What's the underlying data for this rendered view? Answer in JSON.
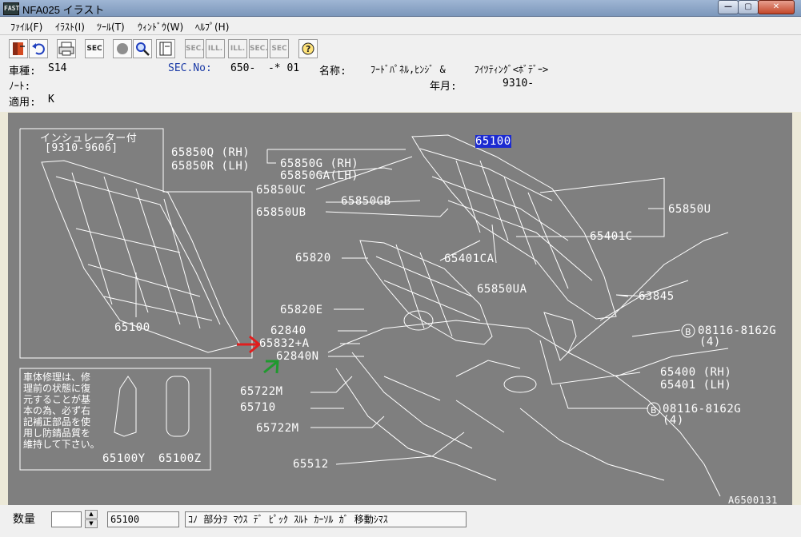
{
  "window": {
    "title": "NFA025 イラスト",
    "app_icon_text": "FAST"
  },
  "menu": [
    "ﾌｧｲﾙ(F)",
    "ｲﾗｽﾄ(I)",
    "ﾂｰﾙ(T)",
    "ｳｨﾝﾄﾞｳ(W)",
    "ﾍﾙﾌﾟ(H)"
  ],
  "toolbar": {
    "sec": "SEC",
    "sec_prev": "SEC.",
    "ill_prev": "ILL.",
    "ill_next": "ILL.",
    "sec_next": "SEC.",
    "sec_q": "SEC"
  },
  "info": {
    "vehicle_label": "車種:",
    "vehicle_value": "S14",
    "sec_label": "SEC.No:",
    "sec_value": "650-  -* 01",
    "name_label": "名称:",
    "name_value": "ﾌｰﾄﾞﾊﾟﾈﾙ,ﾋﾝｼﾞ &     ﾌｲﾂﾃｨﾝｸﾞ<ﾎﾞﾃﾞｰ>",
    "note_label": "ﾉｰﾄ:",
    "date_label": "年月:",
    "date_value": "9310-",
    "apply_label": "適用:",
    "apply_value": "K"
  },
  "illustration": {
    "inset_title": "インシュレーター付",
    "inset_range": "[9310-9606]",
    "inset_part": "65100",
    "note_lines": [
      "車体修理は、修",
      "理前の状態に復",
      "元することが基",
      "本の為、必ず右",
      "記補正部品を使",
      "用し防錆品質を",
      "維持して下さい。"
    ],
    "part_labels": {
      "p65100_hl": "65100",
      "p65850Q": "65850Q (RH)",
      "p65850R": "65850R (LH)",
      "p65850G": "65850G (RH)",
      "p65850GA": "65850GA(LH)",
      "p65850UC": "65850UC",
      "p65850GB": "65850GB",
      "p65850UB": "65850UB",
      "p65850U": "65850U",
      "p65401C": "65401C",
      "p65820": "65820",
      "p65401CA": "65401CA",
      "p65850UA": "65850UA",
      "p63845": "63845",
      "p65820E": "65820E",
      "p62840": "62840",
      "p65832A": "65832+A",
      "p62840N": "62840N",
      "p08116a": "08116-8162G",
      "p08116a_qty": "(4)",
      "p65400": "65400 (RH)",
      "p65401": "65401 (LH)",
      "p65722M_1": "65722M",
      "p65710": "65710",
      "p08116b": "08116-8162G",
      "p08116b_qty": "(4)",
      "p65722M_2": "65722M",
      "p65512": "65512",
      "p65100Y": "65100Y",
      "p65100Z": "65100Z",
      "ref_code": "A6500131"
    }
  },
  "status": {
    "qty_label": "数量",
    "part_no": "65100",
    "message": "ｺﾉ 部分ｦ ﾏｳｽ ﾃﾞ ﾋﾟｯｸ ｽﾙﾄ ｶｰｿﾙ ｶﾞ 移動ｼﾏｽ"
  },
  "colors": {
    "canvas_bg": "#7f7f7f",
    "line": "#ffffff",
    "highlight": "#1c2bd1",
    "red_arrow": "#e01e1e",
    "green_arrow": "#1f9a2e"
  }
}
